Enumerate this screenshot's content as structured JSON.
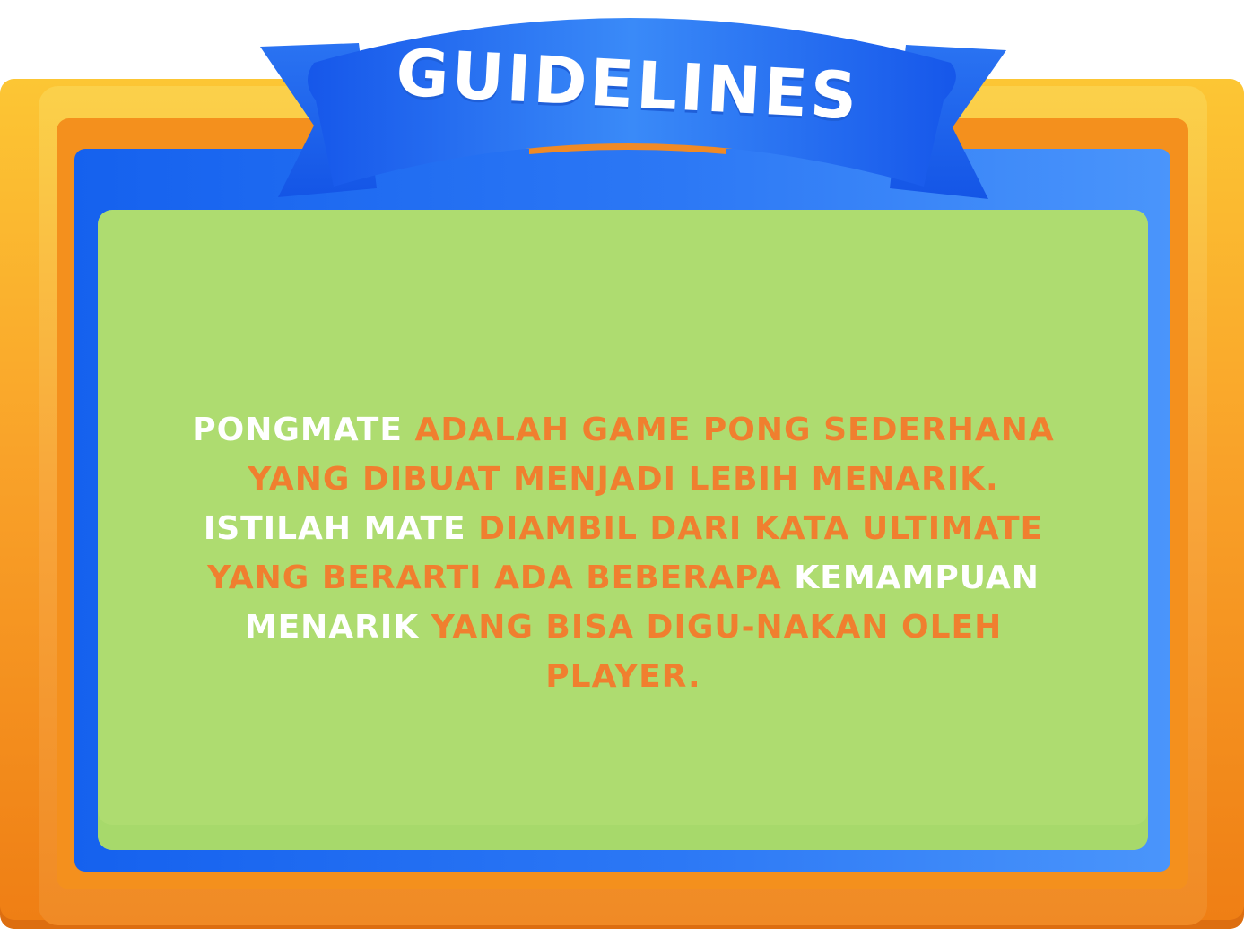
{
  "banner": {
    "title": "GUIDELINES"
  },
  "description": {
    "segments": [
      {
        "text": "Pongmate",
        "highlight": true
      },
      {
        "text": " adalah game pong sederhana yang dibuat menjadi lebih menarik. ",
        "highlight": false
      },
      {
        "text": "Istilah mate",
        "highlight": true
      },
      {
        "text": " diambil dari kata ultimate yang berarti ada beberapa ",
        "highlight": false
      },
      {
        "text": "kemampuan menarik",
        "highlight": true
      },
      {
        "text": " yang bisa digu-nakan oleh player.",
        "highlight": false
      }
    ]
  },
  "colors": {
    "frame_yellow": "#fcc634",
    "frame_orange": "#f4901d",
    "frame_blue": "#2c78f5",
    "panel_green": "#aedc70",
    "text_orange": "#f07f2f",
    "text_highlight": "#ffffff",
    "banner_blue": "#1d63ef"
  }
}
